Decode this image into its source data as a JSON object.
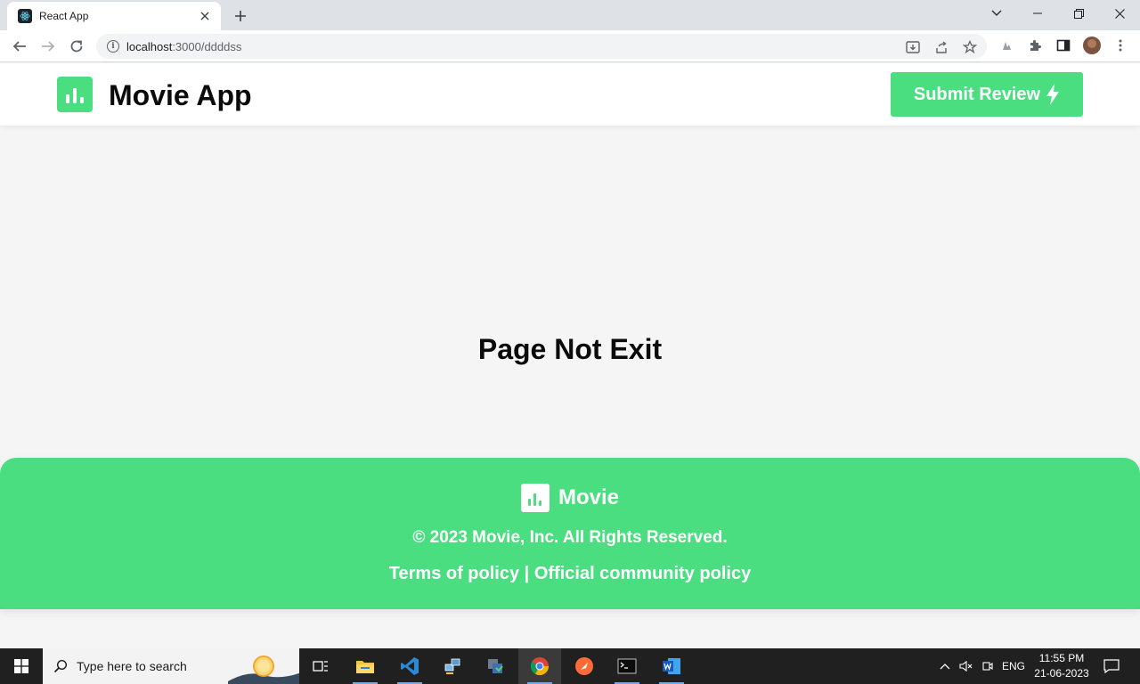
{
  "browser": {
    "tab_title": "React App",
    "url_host": "localhost",
    "url_path": ":3000/ddddss"
  },
  "header": {
    "app_title": "Movie App",
    "submit_label": "Submit Review"
  },
  "main": {
    "message": "Page Not Exit"
  },
  "footer": {
    "brand": "Movie",
    "copyright": "© 2023 Movie, Inc. All Rights Reserved.",
    "link_terms": "Terms of policy",
    "separator": "|",
    "link_community": "Official community policy"
  },
  "taskbar": {
    "search_placeholder": "Type here to search",
    "language": "ENG",
    "time": "11:55 PM",
    "date": "21-06-2023"
  },
  "colors": {
    "accent": "#4ade80",
    "page_bg": "#f5f5f6",
    "text": "#0b0b0b"
  }
}
